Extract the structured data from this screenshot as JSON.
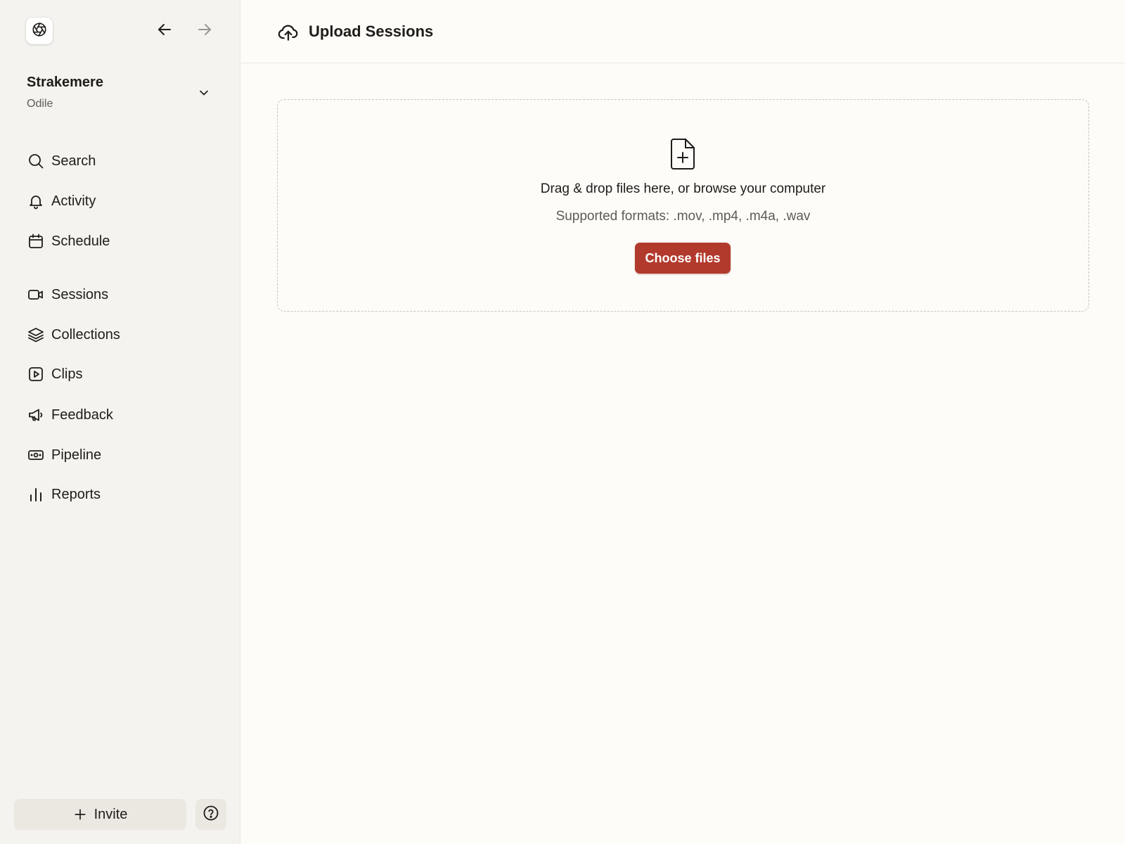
{
  "colors": {
    "sidebar_bg": "#f5f3ef",
    "main_bg": "#fdfcf9",
    "accent": "#b23a2c",
    "text": "#1f1c19",
    "muted": "#5f5a54"
  },
  "sidebar": {
    "logo_icon": "aperture-icon",
    "back_icon": "arrow-left-icon",
    "forward_icon": "arrow-right-icon",
    "workspace": {
      "name": "Strakemere",
      "user": "Odile"
    },
    "items": [
      {
        "label": "Search",
        "icon": "search-icon"
      },
      {
        "label": "Activity",
        "icon": "bell-icon"
      },
      {
        "label": "Schedule",
        "icon": "calendar-icon"
      },
      {
        "label": "Sessions",
        "icon": "video-camera-icon"
      },
      {
        "label": "Collections",
        "icon": "layers-icon"
      },
      {
        "label": "Clips",
        "icon": "play-square-icon"
      },
      {
        "label": "Feedback",
        "icon": "megaphone-icon"
      },
      {
        "label": "Pipeline",
        "icon": "money-icon"
      },
      {
        "label": "Reports",
        "icon": "bar-chart-icon"
      }
    ],
    "invite_label": "Invite",
    "help_icon": "question-circle-icon"
  },
  "header": {
    "title": "Upload Sessions",
    "icon": "cloud-upload-icon"
  },
  "dropzone": {
    "icon": "file-plus-icon",
    "title": "Drag & drop files here, or browse your computer",
    "subtitle": "Supported formats: .mov, .mp4, .m4a, .wav",
    "button_label": "Choose files"
  }
}
